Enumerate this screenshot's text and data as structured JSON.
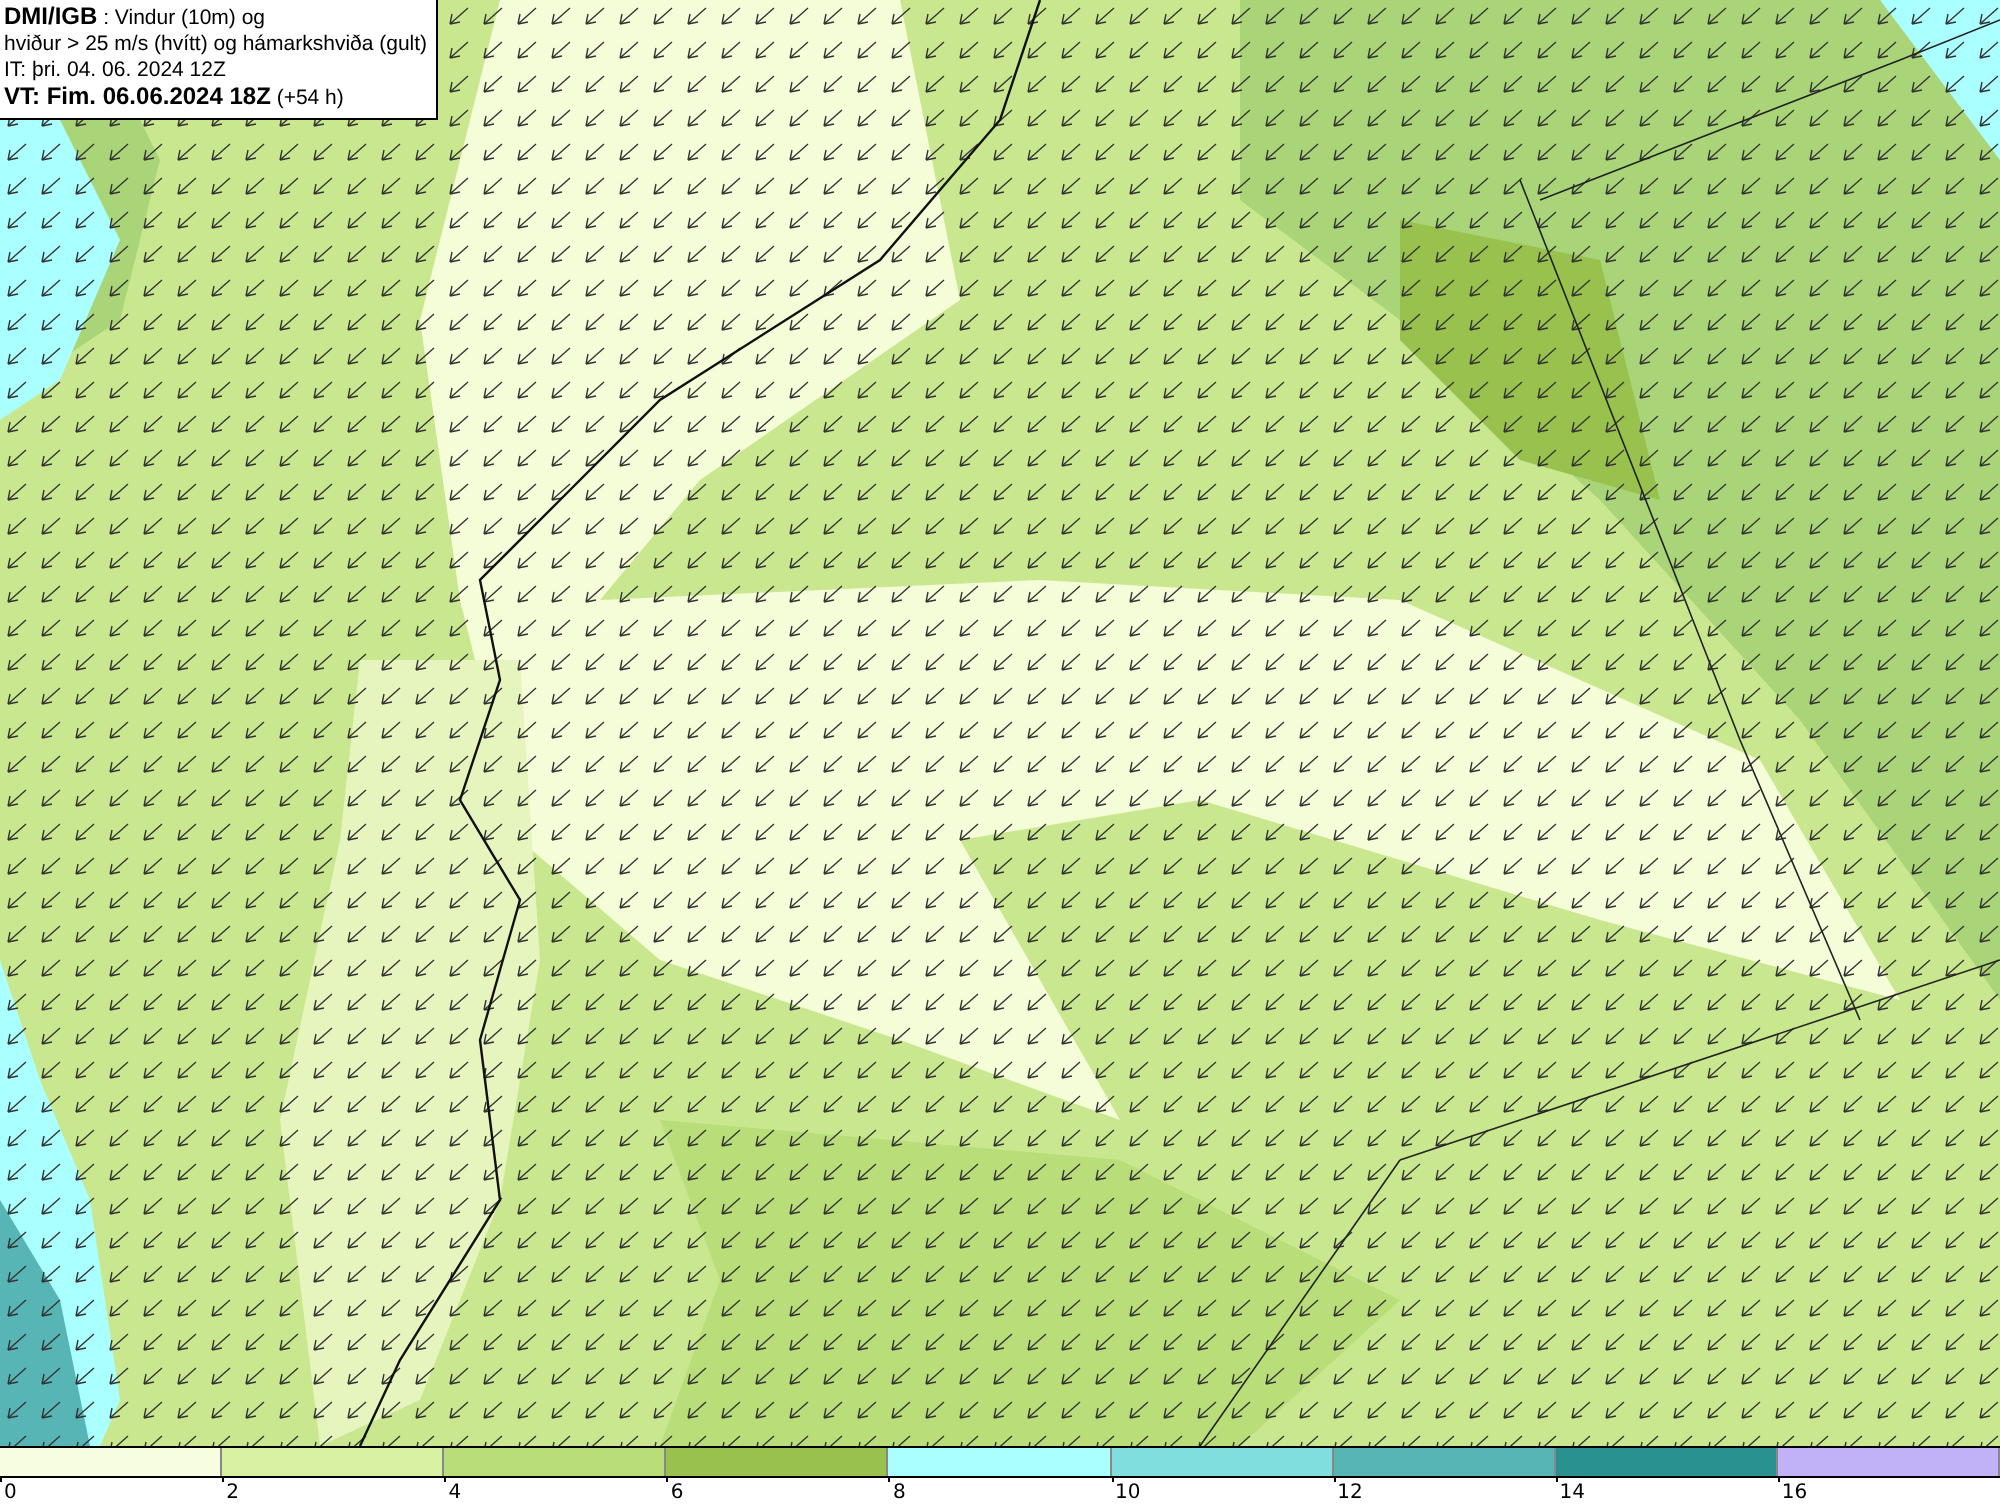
{
  "info_box": {
    "lines": [
      "**DMI/IGB** : Vindur (10m) og",
      "hviður > 25 m/s (hvítt) og hámarkshviða (gult)",
      "IT: þri. 04. 06. 2024 12Z",
      "**VT: Fim. 06.06.2024 18Z** (+54 h)"
    ]
  },
  "legend": {
    "bins": [
      {
        "color": "#f7fde0"
      },
      {
        "color": "#d9f1a3"
      },
      {
        "color": "#b8dd79"
      },
      {
        "color": "#98c24d"
      },
      {
        "color": "#aaffff"
      },
      {
        "color": "#80dede"
      },
      {
        "color": "#58b5b5"
      },
      {
        "color": "#2a9191"
      },
      {
        "color": "#c1b2f7"
      }
    ],
    "ticks": [
      "0",
      "2",
      "4",
      "6",
      "8",
      "10",
      "12",
      "14",
      "16"
    ]
  }
}
